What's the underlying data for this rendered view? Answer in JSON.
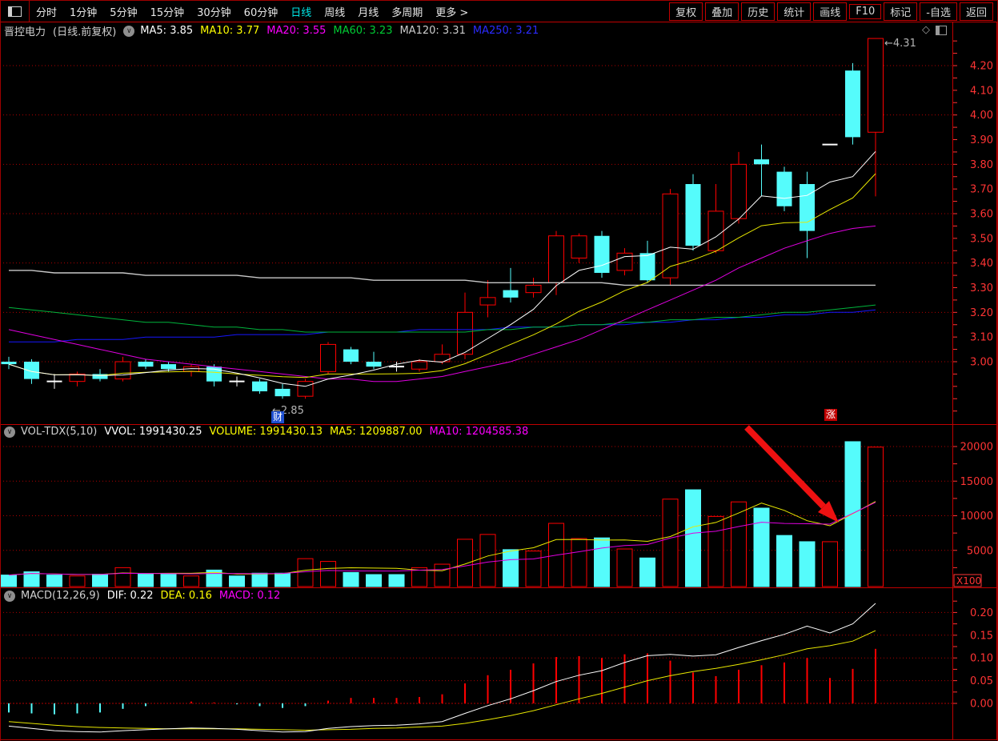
{
  "toolbar": {
    "left_items": [
      "分时",
      "1分钟",
      "5分钟",
      "15分钟",
      "30分钟",
      "60分钟",
      "日线",
      "周线",
      "月线",
      "多周期",
      "更多 >"
    ],
    "active_item": "日线",
    "right_buttons": [
      "复权",
      "叠加",
      "历史",
      "统计",
      "画线",
      "F10",
      "标记",
      "-自选",
      "返回"
    ]
  },
  "main_panel": {
    "title": "晋控电力",
    "period_label": "(日线.前复权)",
    "ma_labels": [
      {
        "text": "MA5: 3.85",
        "color": "#ffffff"
      },
      {
        "text": "MA10: 3.77",
        "color": "#ffff00"
      },
      {
        "text": "MA20: 3.55",
        "color": "#ff00ff"
      },
      {
        "text": "MA60: 3.23",
        "color": "#00cc33"
      },
      {
        "text": "MA120: 3.31",
        "color": "#cccccc"
      },
      {
        "text": "MA250: 3.21",
        "color": "#2b2bff"
      }
    ],
    "price_axis_labels": [
      "4.20",
      "4.10",
      "4.00",
      "3.90",
      "3.80",
      "3.70",
      "3.60",
      "3.50",
      "3.40",
      "3.30",
      "3.20",
      "3.10",
      "3.00"
    ],
    "annotations": {
      "high_label": "4.31",
      "low_label": "2.85",
      "cai_badge": "财",
      "zhang_badge": "涨"
    }
  },
  "volume_panel": {
    "indicator_label": "VOL-TDX(5,10)",
    "fields": [
      {
        "text": "VVOL: 1991430.25",
        "color": "#ffffff"
      },
      {
        "text": "VOLUME: 1991430.13",
        "color": "#ffff00"
      },
      {
        "text": "MA5: 1209887.00",
        "color": "#ffff00"
      },
      {
        "text": "MA10: 1204585.38",
        "color": "#ff00ff"
      }
    ],
    "axis_labels": [
      "20000",
      "15000",
      "10000",
      "5000"
    ],
    "unit_label": "X100"
  },
  "macd_panel": {
    "indicator_label": "MACD(12,26,9)",
    "fields": [
      {
        "text": "DIF: 0.22",
        "color": "#ffffff"
      },
      {
        "text": "DEA: 0.16",
        "color": "#ffff00"
      },
      {
        "text": "MACD: 0.12",
        "color": "#ff00ff"
      }
    ],
    "axis_labels": [
      "0.20",
      "0.15",
      "0.10",
      "0.05",
      "0.00"
    ]
  },
  "colors": {
    "up": "#ff0000",
    "down": "#55fcfc",
    "doji": "#ffffff",
    "grid": "#b00000",
    "frame": "#c00000",
    "axis_text": "#ff3434",
    "ma5": "#ffffff",
    "ma10": "#e8e800",
    "ma20": "#e000e0",
    "ma60": "#00b43c",
    "ma120": "#c8c8c8",
    "ma250": "#1616ff",
    "vol_ma5": "#e8e800",
    "vol_ma10": "#e000e0",
    "dif": "#ffffff",
    "dea": "#e8e800",
    "arrow": "#ee1111",
    "marker_text": "#b4b4b4",
    "badge_cai_bg": "#1e4fd0",
    "badge_zhang_bg": "#c00000"
  },
  "chart_data": {
    "type": "candlestick",
    "panels": [
      "price",
      "volume",
      "macd"
    ],
    "price_gridlines": [
      3.0,
      3.2,
      3.4,
      3.6,
      3.8,
      4.0,
      4.2
    ],
    "volume_gridlines": [
      5000,
      10000,
      15000,
      20000
    ],
    "macd_gridlines": [
      0.0,
      0.05,
      0.1,
      0.15,
      0.2
    ],
    "open": [
      3.0,
      3.0,
      2.92,
      2.92,
      2.95,
      2.93,
      3.0,
      2.99,
      2.96,
      2.98,
      2.92,
      2.92,
      2.89,
      2.86,
      2.96,
      3.05,
      3.0,
      2.98,
      2.97,
      3.0,
      3.03,
      3.23,
      3.29,
      3.28,
      3.32,
      3.42,
      3.51,
      3.37,
      3.44,
      3.34,
      3.72,
      3.45,
      3.58,
      3.82,
      3.77,
      3.72,
      3.88,
      4.18,
      3.93
    ],
    "high": [
      3.02,
      3.01,
      2.95,
      2.96,
      2.97,
      3.02,
      3.01,
      3.0,
      2.99,
      2.99,
      2.94,
      2.93,
      2.91,
      2.93,
      3.08,
      3.06,
      3.04,
      3.0,
      3.01,
      3.07,
      3.28,
      3.33,
      3.38,
      3.34,
      3.53,
      3.52,
      3.53,
      3.46,
      3.49,
      3.7,
      3.76,
      3.72,
      3.85,
      3.88,
      3.79,
      3.77,
      3.88,
      4.21,
      4.31
    ],
    "low": [
      2.97,
      2.91,
      2.89,
      2.9,
      2.92,
      2.92,
      2.97,
      2.96,
      2.94,
      2.9,
      2.9,
      2.87,
      2.85,
      2.85,
      2.95,
      2.99,
      2.97,
      2.96,
      2.96,
      2.99,
      3.01,
      3.18,
      3.24,
      3.26,
      3.27,
      3.4,
      3.34,
      3.35,
      3.32,
      3.31,
      3.45,
      3.44,
      3.56,
      3.67,
      3.61,
      3.42,
      3.88,
      3.88,
      3.67
    ],
    "close": [
      2.99,
      2.93,
      2.92,
      2.95,
      2.93,
      3.0,
      2.98,
      2.97,
      2.98,
      2.92,
      2.92,
      2.88,
      2.86,
      2.92,
      3.07,
      3.0,
      2.98,
      2.98,
      3.0,
      3.03,
      3.2,
      3.26,
      3.26,
      3.31,
      3.51,
      3.51,
      3.36,
      3.44,
      3.33,
      3.68,
      3.47,
      3.61,
      3.8,
      3.8,
      3.63,
      3.53,
      3.88,
      3.91,
      4.31
    ],
    "volume_x100": [
      1430,
      1900,
      1430,
      1300,
      1550,
      2500,
      1550,
      1550,
      1300,
      2150,
      1300,
      1700,
      1700,
      3800,
      3400,
      1800,
      1500,
      1500,
      2500,
      3000,
      6600,
      7300,
      5100,
      4900,
      8900,
      6700,
      6800,
      5200,
      3900,
      12400,
      13750,
      9900,
      12000,
      11100,
      7150,
      6250,
      6250,
      20700,
      19914
    ],
    "ma20": [
      3.13,
      3.11,
      3.09,
      3.07,
      3.05,
      3.03,
      3.01,
      3.0,
      2.99,
      2.98,
      2.97,
      2.96,
      2.95,
      2.94,
      2.93,
      2.93,
      2.92,
      2.92,
      2.93,
      2.94,
      2.96,
      2.98,
      3.0,
      3.03,
      3.06,
      3.09,
      3.13,
      3.17,
      3.21,
      3.25,
      3.29,
      3.33,
      3.38,
      3.42,
      3.46,
      3.49,
      3.52,
      3.54,
      3.55
    ],
    "ma60": [
      3.22,
      3.21,
      3.2,
      3.19,
      3.18,
      3.17,
      3.16,
      3.16,
      3.15,
      3.14,
      3.14,
      3.13,
      3.13,
      3.12,
      3.12,
      3.12,
      3.12,
      3.12,
      3.12,
      3.12,
      3.12,
      3.13,
      3.13,
      3.14,
      3.14,
      3.15,
      3.15,
      3.16,
      3.16,
      3.17,
      3.17,
      3.18,
      3.18,
      3.19,
      3.2,
      3.2,
      3.21,
      3.22,
      3.23
    ],
    "ma120": [
      3.37,
      3.37,
      3.36,
      3.36,
      3.36,
      3.36,
      3.35,
      3.35,
      3.35,
      3.35,
      3.35,
      3.34,
      3.34,
      3.34,
      3.34,
      3.34,
      3.33,
      3.33,
      3.33,
      3.33,
      3.33,
      3.32,
      3.32,
      3.32,
      3.32,
      3.32,
      3.32,
      3.31,
      3.31,
      3.31,
      3.31,
      3.31,
      3.31,
      3.31,
      3.31,
      3.31,
      3.31,
      3.31,
      3.31
    ],
    "ma250": [
      3.08,
      3.08,
      3.08,
      3.09,
      3.09,
      3.09,
      3.1,
      3.1,
      3.1,
      3.1,
      3.11,
      3.11,
      3.11,
      3.11,
      3.12,
      3.12,
      3.12,
      3.12,
      3.13,
      3.13,
      3.13,
      3.13,
      3.14,
      3.14,
      3.14,
      3.15,
      3.15,
      3.15,
      3.16,
      3.16,
      3.17,
      3.17,
      3.18,
      3.18,
      3.19,
      3.19,
      3.2,
      3.2,
      3.21
    ],
    "dif": [
      -0.05,
      -0.055,
      -0.06,
      -0.062,
      -0.063,
      -0.06,
      -0.058,
      -0.056,
      -0.054,
      -0.055,
      -0.057,
      -0.06,
      -0.063,
      -0.062,
      -0.055,
      -0.051,
      -0.049,
      -0.048,
      -0.045,
      -0.04,
      -0.022,
      -0.005,
      0.01,
      0.028,
      0.048,
      0.062,
      0.072,
      0.09,
      0.105,
      0.108,
      0.104,
      0.107,
      0.123,
      0.138,
      0.152,
      0.17,
      0.155,
      0.175,
      0.22
    ],
    "dea": [
      -0.04,
      -0.044,
      -0.048,
      -0.051,
      -0.053,
      -0.054,
      -0.055,
      -0.056,
      -0.056,
      -0.056,
      -0.056,
      -0.057,
      -0.058,
      -0.059,
      -0.058,
      -0.057,
      -0.055,
      -0.054,
      -0.052,
      -0.05,
      -0.044,
      -0.036,
      -0.027,
      -0.016,
      -0.003,
      0.01,
      0.022,
      0.036,
      0.05,
      0.061,
      0.07,
      0.077,
      0.086,
      0.096,
      0.107,
      0.12,
      0.127,
      0.137,
      0.16
    ],
    "macd_hist": [
      -0.02,
      -0.022,
      -0.024,
      -0.022,
      -0.02,
      -0.012,
      -0.006,
      0.0,
      0.004,
      0.002,
      -0.002,
      -0.006,
      -0.01,
      -0.006,
      0.006,
      0.012,
      0.012,
      0.012,
      0.014,
      0.02,
      0.044,
      0.062,
      0.074,
      0.088,
      0.102,
      0.104,
      0.1,
      0.108,
      0.11,
      0.094,
      0.068,
      0.06,
      0.074,
      0.084,
      0.09,
      0.1,
      0.056,
      0.076,
      0.12
    ]
  }
}
